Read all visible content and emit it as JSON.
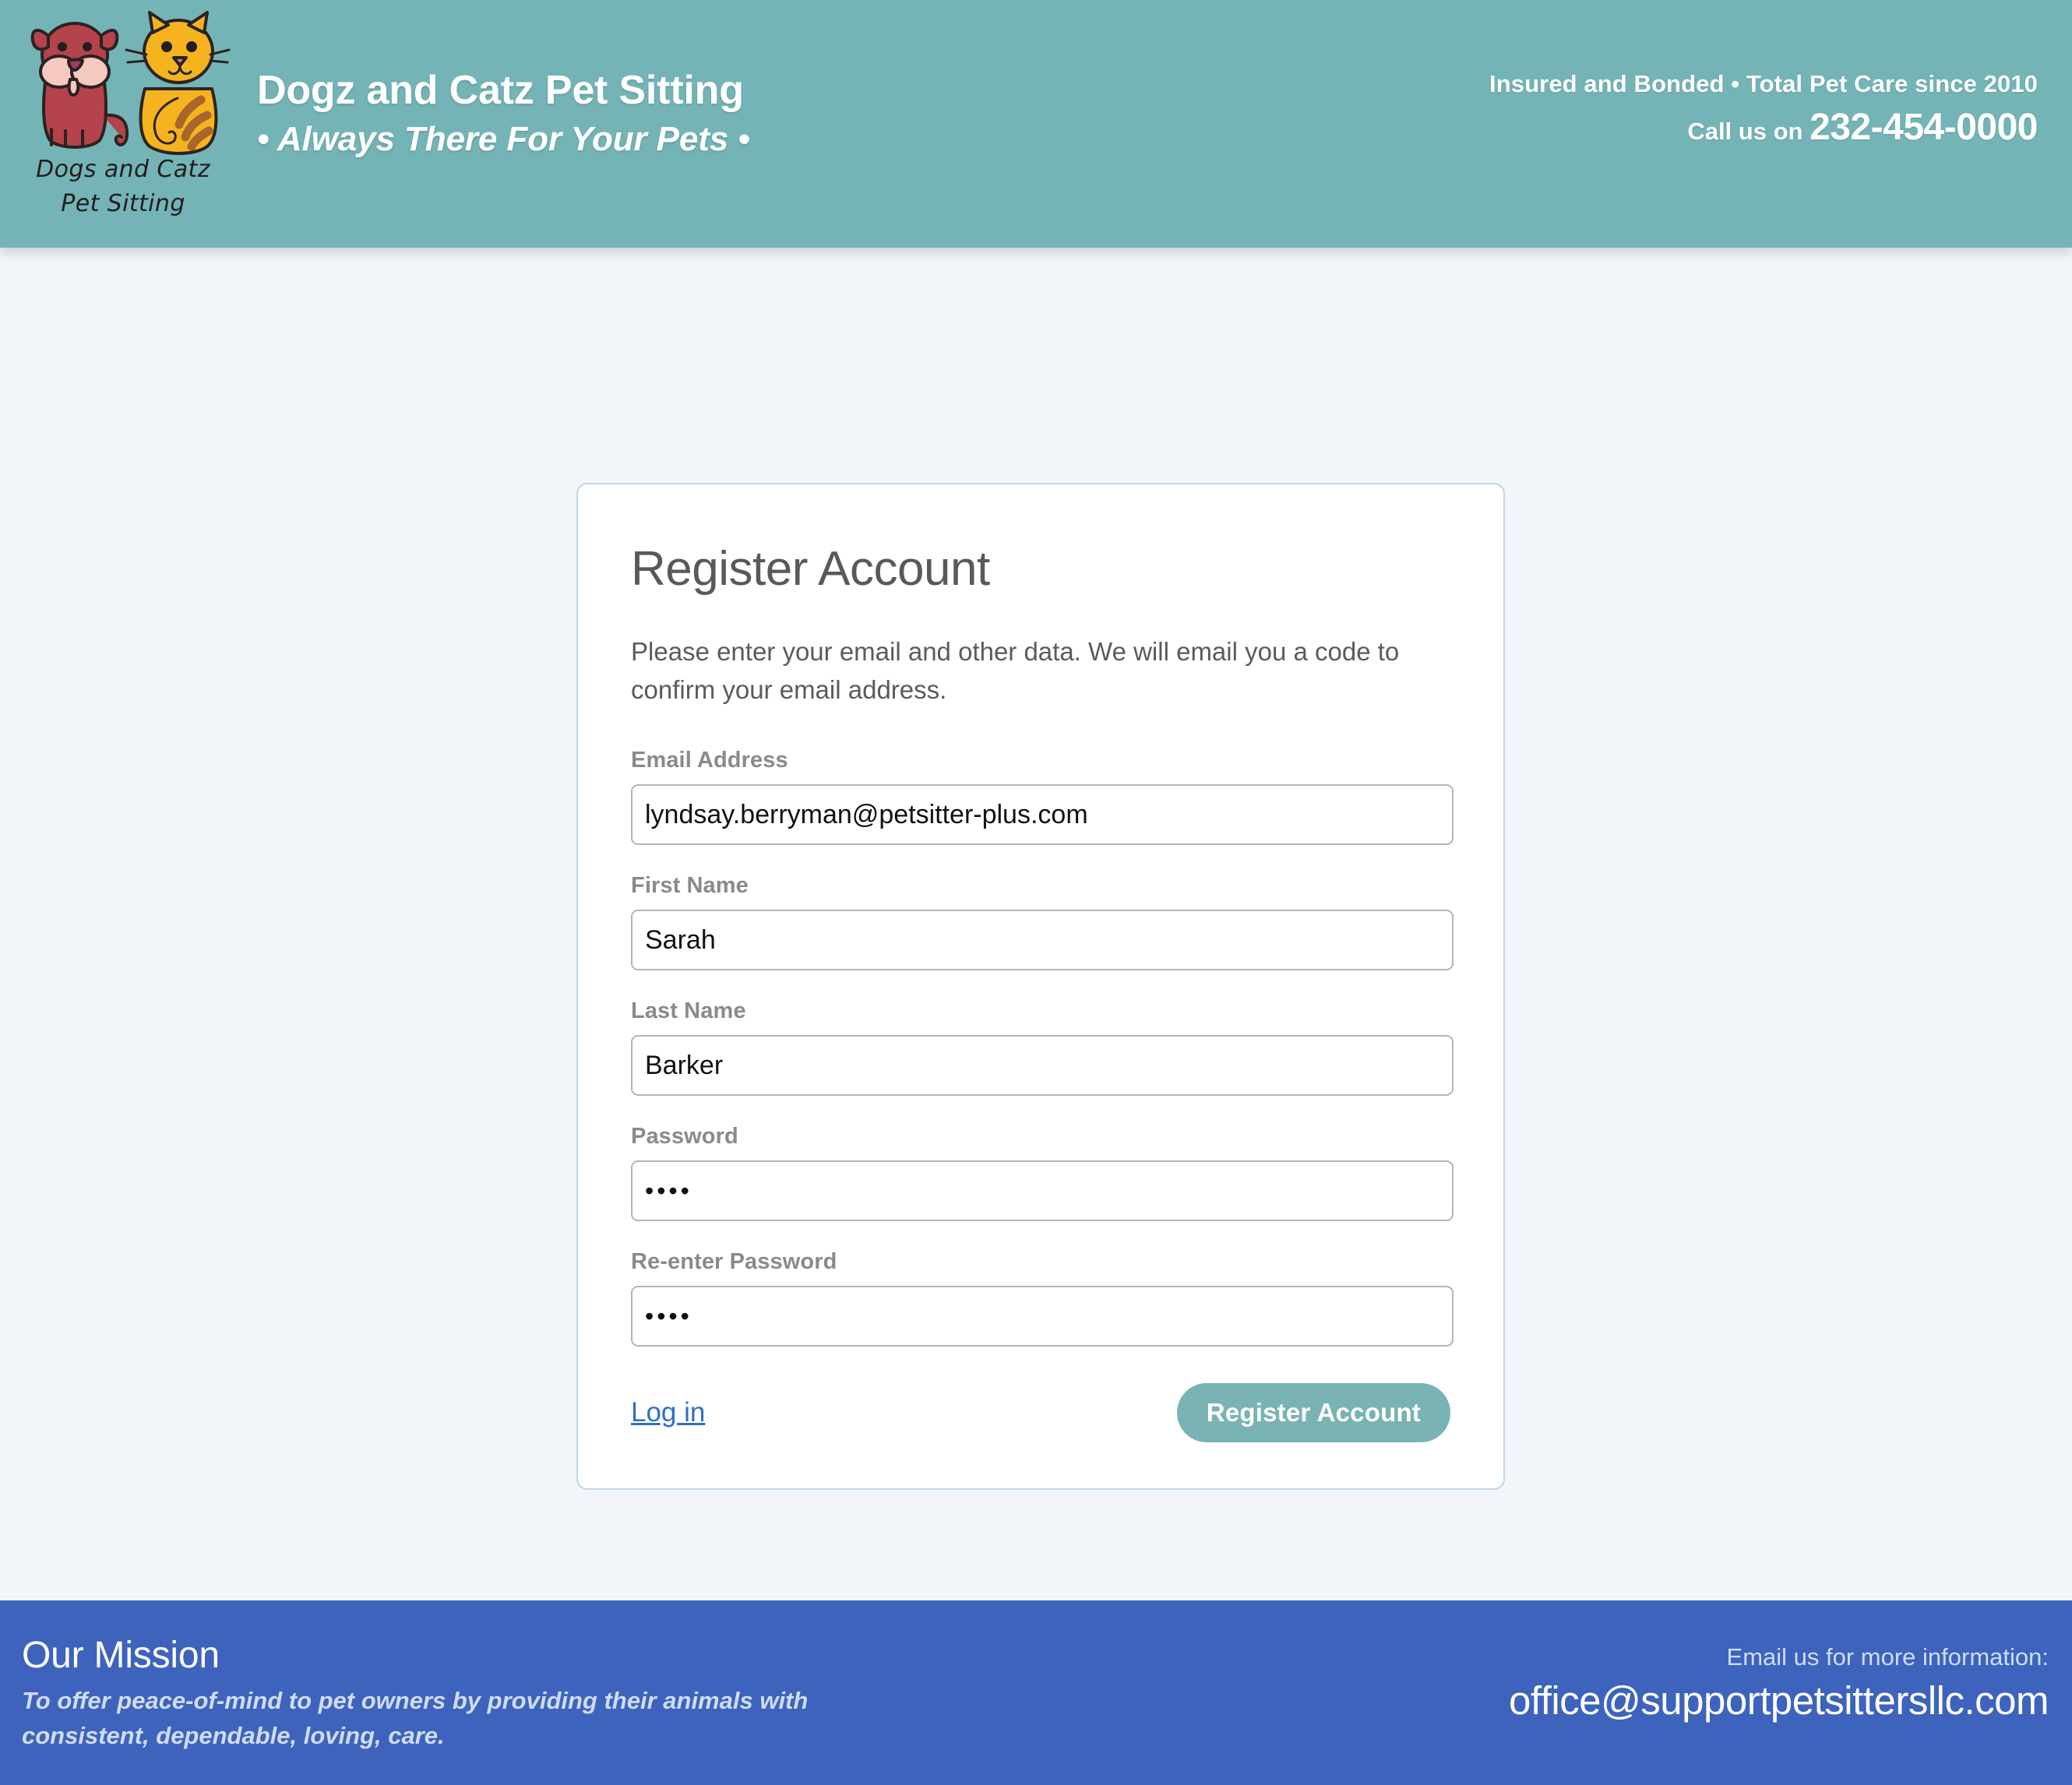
{
  "header": {
    "logo_wordmark_line1": "Dogs and Catz",
    "logo_wordmark_line2": "Pet Sitting",
    "title": "Dogz and Catz Pet Sitting",
    "tagline": "• Always There For Your Pets •",
    "insured_text": "Insured and Bonded • Total Pet Care since 2010",
    "call_label": "Call us on",
    "phone": "232-454-0000",
    "background_color": "#74b4b7"
  },
  "card": {
    "title": "Register Account",
    "intro": "Please enter your email and other data. We will email you a code to confirm your email address.",
    "fields": [
      {
        "label": "Email Address",
        "value": "lyndsay.berryman@petsitter-plus.com",
        "placeholder": "",
        "type": "email"
      },
      {
        "label": "First Name",
        "value": "Sarah",
        "placeholder": "",
        "type": "text"
      },
      {
        "label": "Last Name",
        "value": "Barker",
        "placeholder": "",
        "type": "text"
      },
      {
        "label": "Password",
        "value": "••••",
        "placeholder": "",
        "type": "password"
      },
      {
        "label": "Re-enter Password",
        "value": "••••",
        "placeholder": "",
        "type": "password"
      }
    ],
    "login_link": "Log in",
    "submit_label": "Register Account",
    "border_color": "#bcd7ea",
    "button_color": "#79b3b3",
    "link_color": "#2f6fc2"
  },
  "footer": {
    "mission_title": "Our Mission",
    "mission_text": "To offer peace-of-mind to pet owners by providing their animals with consistent, dependable, loving, care.",
    "email_label": "Email us for more information:",
    "email": "office@supportpetsittersllc.com",
    "background_color": "#3e63bd"
  },
  "page": {
    "background_color": "#f2f6fb"
  }
}
